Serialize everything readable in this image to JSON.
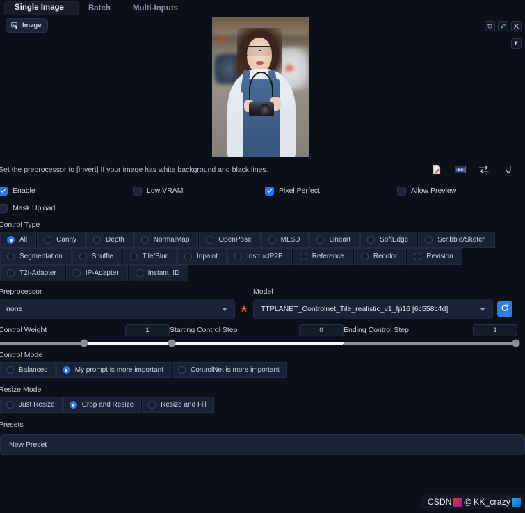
{
  "tabs": [
    {
      "label": "Single Image",
      "active": true
    },
    {
      "label": "Batch",
      "active": false
    },
    {
      "label": "Multi-Inputs",
      "active": false
    }
  ],
  "image_panel": {
    "upload_button_label": "Image",
    "upload_icon": "image-upload-icon",
    "tools": [
      {
        "name": "undo-icon",
        "glyph": "↺"
      },
      {
        "name": "edit-pencil-icon",
        "glyph": "✎"
      },
      {
        "name": "close-icon",
        "glyph": "✕"
      },
      {
        "name": "brush-icon",
        "glyph": "✏"
      }
    ]
  },
  "hint": {
    "text": "Set the preprocessor to [invert] If your image has white background and black lines.",
    "action_icons": [
      {
        "name": "new-canvas-icon"
      },
      {
        "name": "camera-icon"
      },
      {
        "name": "swap-icon"
      },
      {
        "name": "send-dimensions-icon"
      }
    ]
  },
  "checkboxes": [
    {
      "label": "Enable",
      "checked": true
    },
    {
      "label": "Low VRAM",
      "checked": false
    },
    {
      "label": "Pixel Perfect",
      "checked": true
    },
    {
      "label": "Allow Preview",
      "checked": false
    },
    {
      "label": "Mask Upload",
      "checked": false
    }
  ],
  "control_type": {
    "label": "Control Type",
    "selected": "All",
    "options": [
      "All",
      "Canny",
      "Depth",
      "NormalMap",
      "OpenPose",
      "MLSD",
      "Lineart",
      "SoftEdge",
      "Scribble/Sketch",
      "Segmentation",
      "Shuffle",
      "Tile/Blur",
      "Inpaint",
      "InstructP2P",
      "Reference",
      "Recolor",
      "Revision",
      "T2I-Adapter",
      "IP-Adapter",
      "Instant_ID"
    ]
  },
  "preprocessor": {
    "label": "Preprocessor",
    "value": "none"
  },
  "model": {
    "label": "Model",
    "value": "TTPLANET_Controlnet_Tile_realistic_v1_fp16 [6c558c4d]",
    "refresh_icon": "refresh-icon"
  },
  "sliders": [
    {
      "label": "Control Weight",
      "value": "1",
      "percent": 50
    },
    {
      "label": "Starting Control Step",
      "value": "0",
      "percent": 0
    },
    {
      "label": "Ending Control Step",
      "value": "1",
      "percent": 100
    }
  ],
  "control_mode": {
    "label": "Control Mode",
    "selected": "My prompt is more important",
    "options": [
      "Balanced",
      "My prompt is more important",
      "ControlNet is more important"
    ]
  },
  "resize_mode": {
    "label": "Resize Mode",
    "selected": "Crop and Resize",
    "options": [
      "Just Resize",
      "Crop and Resize",
      "Resize and Fill"
    ]
  },
  "presets": {
    "label": "Presets",
    "value": "New Preset"
  },
  "watermark": {
    "text_prefix": "CSDN",
    "text_suffix": "KK_crazy",
    "at": "@"
  },
  "colors": {
    "accent": "#2a74ef",
    "background": "#0b0f19",
    "panel": "#1b2233",
    "refresh": "#2b7fe0"
  }
}
